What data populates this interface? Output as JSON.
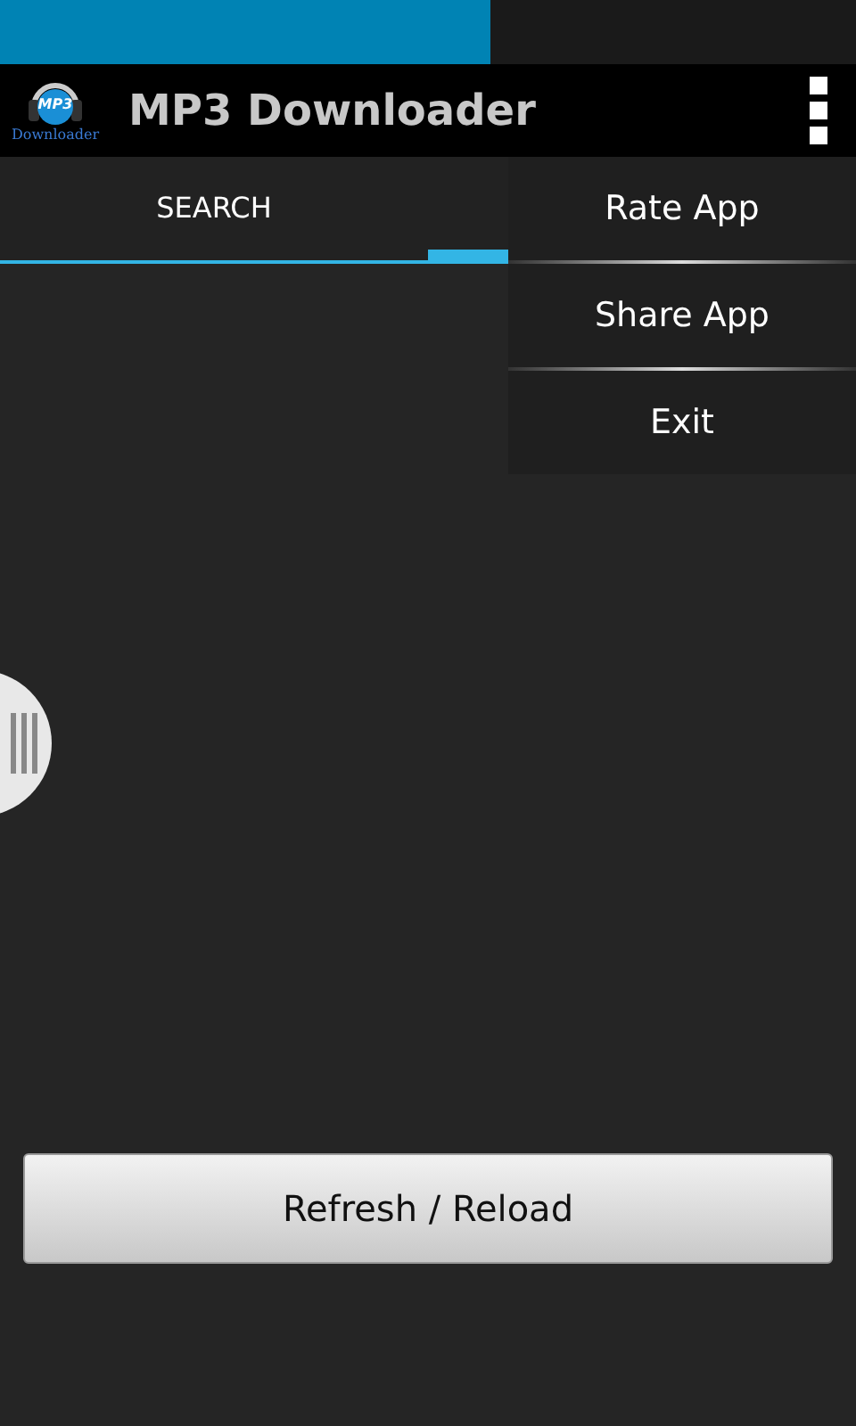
{
  "status_bar": {
    "level": 0.573
  },
  "app_bar": {
    "logo_text": "MP3",
    "logo_caption": "Downloader",
    "title": "MP3 Downloader"
  },
  "tabs": [
    {
      "label": "SEARCH",
      "selected": true
    }
  ],
  "overflow_menu": {
    "items": [
      {
        "label": "Rate App"
      },
      {
        "label": "Share App"
      },
      {
        "label": "Exit"
      }
    ]
  },
  "refresh_button": {
    "label": "Refresh / Reload"
  }
}
